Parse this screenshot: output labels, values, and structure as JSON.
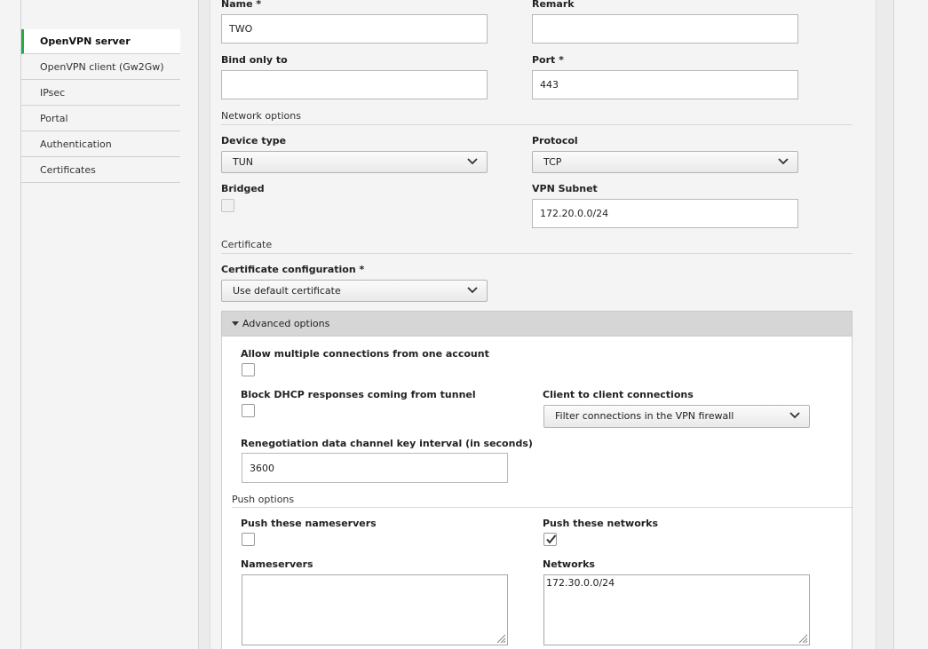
{
  "sidebar": {
    "items": [
      {
        "label": "OpenVPN server",
        "active": true
      },
      {
        "label": "OpenVPN client (Gw2Gw)"
      },
      {
        "label": "IPsec"
      },
      {
        "label": "Portal"
      },
      {
        "label": "Authentication"
      },
      {
        "label": "Certificates"
      }
    ]
  },
  "form": {
    "name_label": "Name *",
    "name_value": "TWO",
    "remark_label": "Remark",
    "remark_value": "",
    "bind_label": "Bind only to",
    "bind_value": "",
    "port_label": "Port *",
    "port_value": "443",
    "network_section": "Network options",
    "device_type_label": "Device type",
    "device_type_value": "TUN",
    "protocol_label": "Protocol",
    "protocol_value": "TCP",
    "bridged_label": "Bridged",
    "vpn_subnet_label": "VPN Subnet",
    "vpn_subnet_value": "172.20.0.0/24",
    "certificate_section": "Certificate",
    "cert_config_label": "Certificate configuration *",
    "cert_config_value": "Use default certificate"
  },
  "advanced": {
    "header": "Advanced options",
    "multi_conn_label": "Allow multiple connections from one account",
    "multi_conn_checked": false,
    "block_dhcp_label": "Block DHCP responses coming from tunnel",
    "block_dhcp_checked": false,
    "c2c_label": "Client to client connections",
    "c2c_value": "Filter connections in the VPN firewall",
    "reneg_label": "Renegotiation data channel key interval (in seconds)",
    "reneg_value": "3600",
    "push_section": "Push options",
    "push_ns_label": "Push these nameservers",
    "push_ns_checked": false,
    "push_nets_label": "Push these networks",
    "push_nets_checked": true,
    "nameservers_label": "Nameservers",
    "nameservers_value": "",
    "networks_label": "Networks",
    "networks_value": "172.30.0.0/24"
  }
}
